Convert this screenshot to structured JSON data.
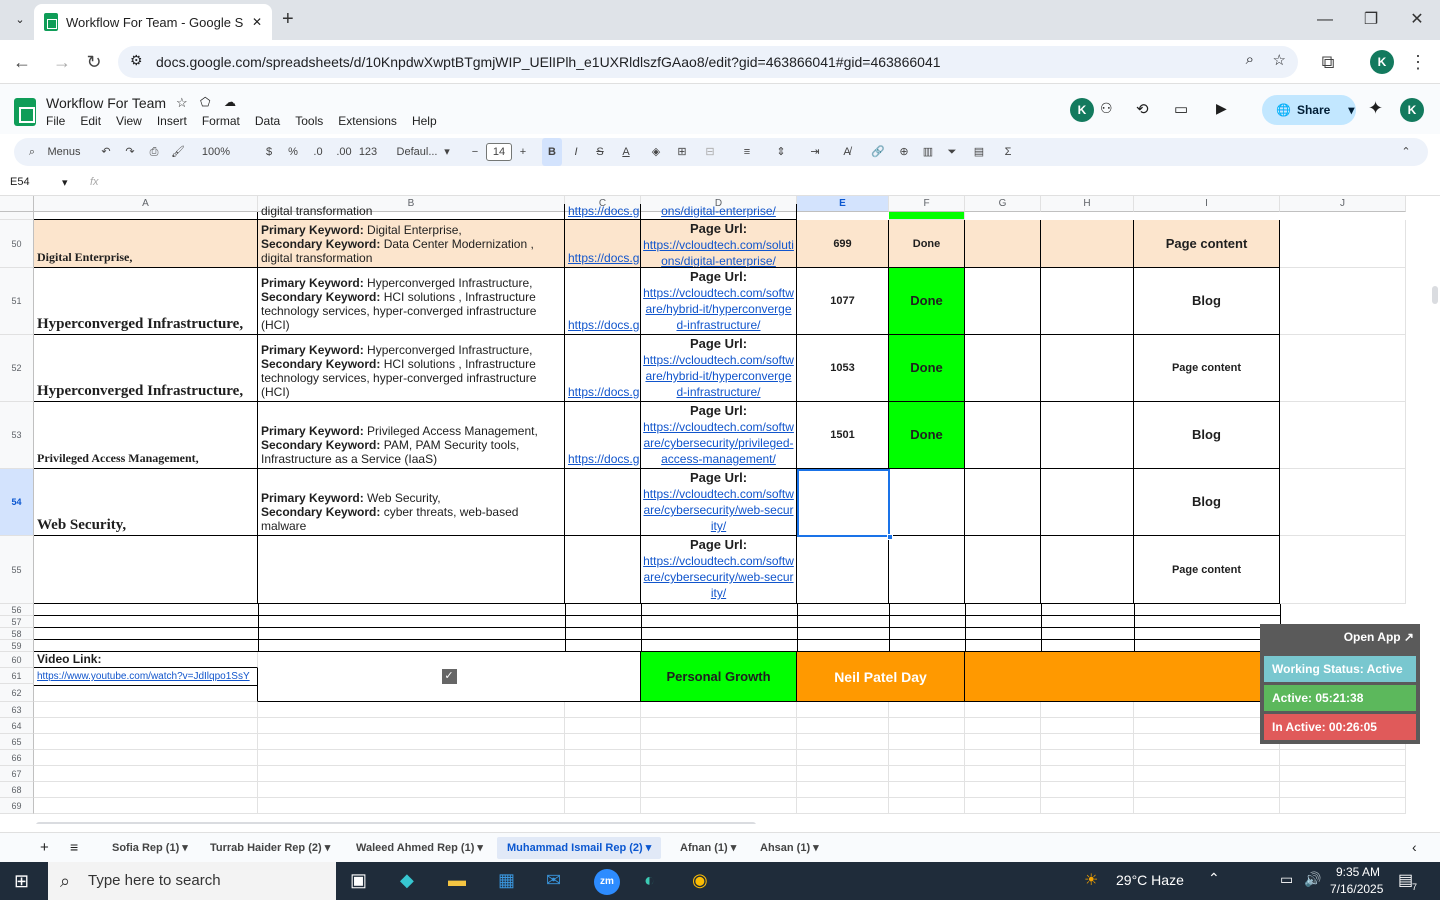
{
  "browser": {
    "tab_title": "Workflow For Team - Google Sh",
    "url": "docs.google.com/spreadsheets/d/10KnpdwXwptBTgmjWIP_UElIPlh_e1UXRldlszfGAao8/edit?gid=463866041#gid=463866041",
    "new_tab": "+",
    "minimize": "—",
    "restore": "❐",
    "close": "✕"
  },
  "doc": {
    "title": "Workflow For Team",
    "menus": [
      "File",
      "Edit",
      "View",
      "Insert",
      "Format",
      "Data",
      "Tools",
      "Extensions",
      "Help"
    ],
    "share_label": "Share",
    "avatar_letter": "K"
  },
  "toolbar": {
    "menus_label": "Menus",
    "zoom": "100%",
    "currency": "$",
    "percent": "%",
    "dec_less": ".0",
    "dec_more": ".00",
    "format_123": "123",
    "font": "Defaul...",
    "font_size": "14",
    "bold": "B",
    "italic": "I",
    "strike": "S",
    "text_color": "A",
    "sigma": "Σ"
  },
  "formula_bar": {
    "cell_ref": "E54",
    "fx": "fx",
    "value": ""
  },
  "columns": [
    "A",
    "B",
    "C",
    "D",
    "E",
    "F",
    "G",
    "H",
    "I",
    "J"
  ],
  "top_partial": {
    "a": "digital transformation",
    "c": "https://docs.g",
    "d": "ons/digital-enterprise/"
  },
  "rows": [
    {
      "num": "50",
      "a": "Digital Enterprise,",
      "b_primary_label": "Primary Keyword:",
      "b_primary": " Digital Enterprise,",
      "b_secondary_label": "Secondary Keyword:",
      "b_secondary": " Data Center Modernization , digital transformation",
      "c": "https://docs.g",
      "d_label": "Page Url:",
      "d_url": "https://vcloudtech.com/solutions/digital-enterprise/",
      "e": "699",
      "f": "Done",
      "i": "Page content"
    },
    {
      "num": "51",
      "a": "Hyperconverged Infrastructure,",
      "b_primary_label": "Primary Keyword:",
      "b_primary": " Hyperconverged Infrastructure,",
      "b_secondary_label": "Secondary Keyword:",
      "b_secondary": " HCI solutions , Infrastructure technology services, hyper-converged infrastructure (HCI)",
      "c": "https://docs.g",
      "d_label": "Page Url:",
      "d_url": "https://vcloudtech.com/software/hybrid-it/hyperconverged-infrastructure/",
      "e": "1077",
      "f": "Done",
      "i": "Blog"
    },
    {
      "num": "52",
      "a": "Hyperconverged Infrastructure,",
      "b_primary_label": "Primary Keyword:",
      "b_primary": " Hyperconverged Infrastructure,",
      "b_secondary_label": "Secondary Keyword:",
      "b_secondary": " HCI solutions , Infrastructure technology services, hyper-converged infrastructure (HCI)",
      "c": "https://docs.g",
      "d_label": "Page Url:",
      "d_url": "https://vcloudtech.com/software/hybrid-it/hyperconverged-infrastructure/",
      "e": "1053",
      "f": "Done",
      "i": "Page content"
    },
    {
      "num": "53",
      "a": "Privileged Access Management,",
      "b_primary_label": "Primary Keyword:",
      "b_primary": " Privileged Access Management,",
      "b_secondary_label": "Secondary Keyword:",
      "b_secondary": " PAM, PAM Security tools, Infrastructure as a Service (IaaS)",
      "c": "https://docs.g",
      "d_label": "Page Url:",
      "d_url": "https://vcloudtech.com/software/cybersecurity/privileged-access-management/",
      "e": "1501",
      "f": "Done",
      "i": "Blog"
    },
    {
      "num": "54",
      "a": "Web Security,",
      "b_primary_label": "Primary Keyword:",
      "b_primary": " Web Security,",
      "b_secondary_label": "Secondary Keyword:",
      "b_secondary": " cyber threats, web-based malware",
      "c": "",
      "d_label": "Page Url:",
      "d_url": "https://vcloudtech.com/software/cybersecurity/web-security/",
      "e": "",
      "f": "",
      "i": "Blog"
    },
    {
      "num": "55",
      "a": "",
      "b_primary_label": "",
      "b_primary": "",
      "b_secondary_label": "",
      "b_secondary": "",
      "c": "",
      "d_label": "Page Url:",
      "d_url": "https://vcloudtech.com/software/cybersecurity/web-security/",
      "e": "",
      "f": "",
      "i": "Page content"
    }
  ],
  "empty_rows": [
    "56",
    "57",
    "58",
    "59"
  ],
  "footer_rows": {
    "video_label": "Video Link:",
    "video_url": "https://www.youtube.com/watch?v=JdIlqpo1SsY",
    "personal_growth": "Personal Growth",
    "neil_patel": "Neil Patel Day",
    "row_nums": [
      "60",
      "61",
      "62"
    ]
  },
  "trailing_rows": [
    "63",
    "64",
    "65",
    "66",
    "67",
    "68",
    "69"
  ],
  "tracker": {
    "open_app": "Open App ↗",
    "working": "Working Status: Active",
    "active": "Active: 05:21:38",
    "inactive": "In Active: 00:26:05"
  },
  "sheet_tabs": [
    "Sofia Rep (1)",
    "Turrab Haider Rep (2)",
    "Waleed Ahmed Rep (1)",
    "Muhammad Ismail Rep (2)",
    "Afnan (1)",
    "Ahsan (1)"
  ],
  "taskbar": {
    "search_placeholder": "Type here to search",
    "weather": "29°C  Haze",
    "time": "9:35 AM",
    "date": "7/16/2025",
    "notif_count": "7"
  },
  "colors": {
    "done_green": "#00ff00",
    "peach": "#fce5cd",
    "orange": "#ff9900",
    "link": "#1155cc"
  }
}
